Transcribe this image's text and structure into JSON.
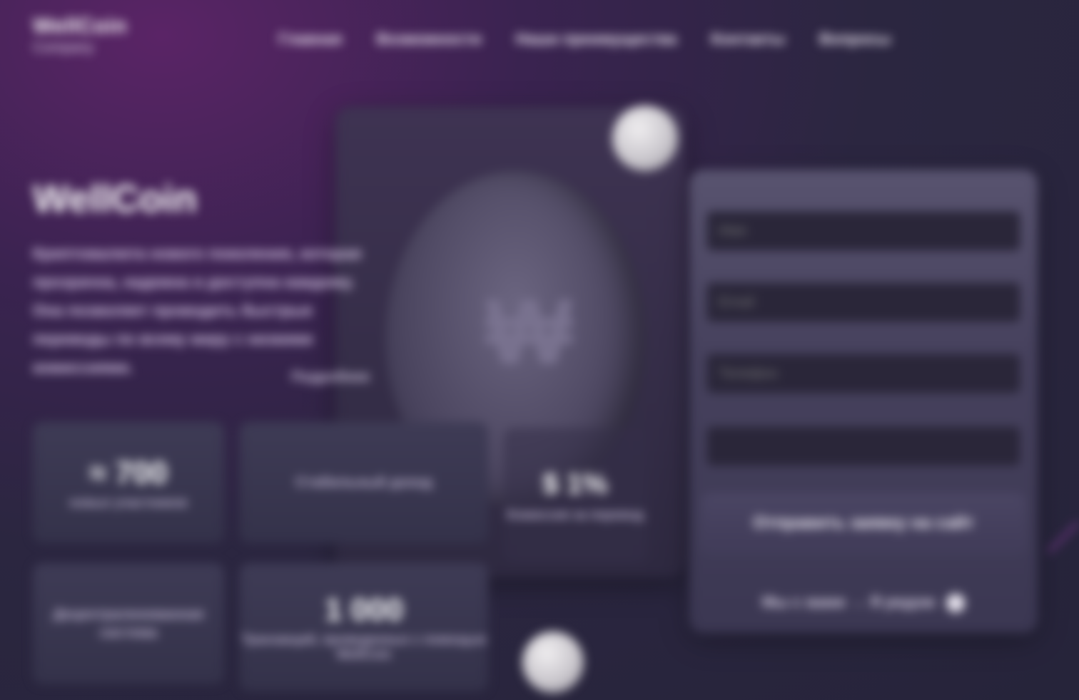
{
  "brand": {
    "name": "WellCoin",
    "sub": "Company"
  },
  "nav": [
    {
      "label": "Главная"
    },
    {
      "label": "Возможности"
    },
    {
      "label": "Наши преимущества"
    },
    {
      "label": "Контакты"
    },
    {
      "label": "Вопросы"
    }
  ],
  "hero": {
    "title": "WellCoin",
    "description": "Криптовалюта нового поколения, которая прозрачна, надежна и доступна каждому. Она позволяет проводить быстрые переводы по всему миру с низкими комиссиями.",
    "more_link": "Подробнее"
  },
  "stats": [
    {
      "value": "≈ 700",
      "label": "новых участников"
    },
    {
      "value": "",
      "label": "Стабильный доход"
    },
    {
      "value": "",
      "label": "Децентрализованная система"
    },
    {
      "value": "1 000",
      "label": "Транзакций, проведенных с помощью WellCoin"
    }
  ],
  "rate": {
    "value": "$ 1%",
    "label": "Комиссия за перевод"
  },
  "form": {
    "name_placeholder": "Имя",
    "email_placeholder": "Email",
    "phone_placeholder": "Телефон",
    "message_placeholder": "",
    "submit_label": "Отправить заявку на сайт",
    "policy_text": "Мы с вами → Я рядом"
  },
  "colors": {
    "accent": "#7b3a8e",
    "background": "#2b2640"
  }
}
